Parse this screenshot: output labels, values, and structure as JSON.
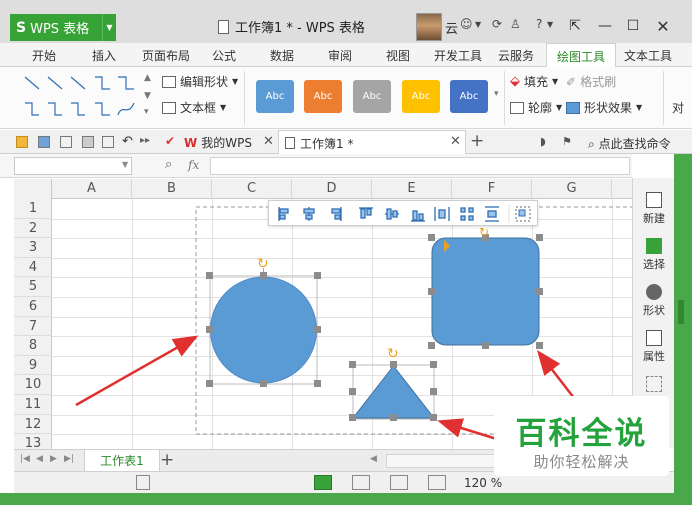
{
  "app": {
    "name": "WPS 表格",
    "logo_glyph": "S",
    "window_title": "工作簿1 * - WPS 表格",
    "user_name": "云"
  },
  "menu": {
    "tabs": [
      "开始",
      "插入",
      "页面布局",
      "公式",
      "数据",
      "审阅",
      "视图",
      "开发工具",
      "云服务",
      "绘图工具",
      "文本工具"
    ],
    "active": "绘图工具"
  },
  "ribbon": {
    "edit_shape": "编辑形状",
    "text_box": "文本框",
    "fill": "填充",
    "format_painter": "格式刷",
    "outline": "轮廓",
    "shape_effect": "形状效果",
    "align_partial": "对",
    "style_label": "Abc",
    "style_colors": [
      "#5b9bd5",
      "#ed7d31",
      "#a5a5a5",
      "#ffc000",
      "#4472c4"
    ]
  },
  "doc_tabs": {
    "mywps": "我的WPS",
    "workbook": "工作簿1 *",
    "find_command": "点此查找命令"
  },
  "formula_bar": {
    "fx": "fx"
  },
  "grid": {
    "columns": [
      "A",
      "B",
      "C",
      "D",
      "E",
      "F",
      "G"
    ],
    "rows": [
      "1",
      "2",
      "3",
      "4",
      "5",
      "6",
      "7",
      "8",
      "9",
      "10",
      "11",
      "12",
      "13"
    ]
  },
  "side_panel": {
    "items": [
      "新建",
      "选择",
      "形状",
      "属性"
    ]
  },
  "sheet_bar": {
    "sheet_name": "工作表1",
    "add": "+"
  },
  "status_bar": {
    "zoom": "120 %"
  },
  "watermark": {
    "title": "百科全说",
    "subtitle": "助你轻松解决"
  },
  "colors": {
    "shape_fill": "#5b9bd5",
    "shape_stroke": "#41719c",
    "arrow": "#e03030",
    "accent_green": "#37a337",
    "handle": "#8c8c8c",
    "rotate_handle": "#f0a020"
  }
}
